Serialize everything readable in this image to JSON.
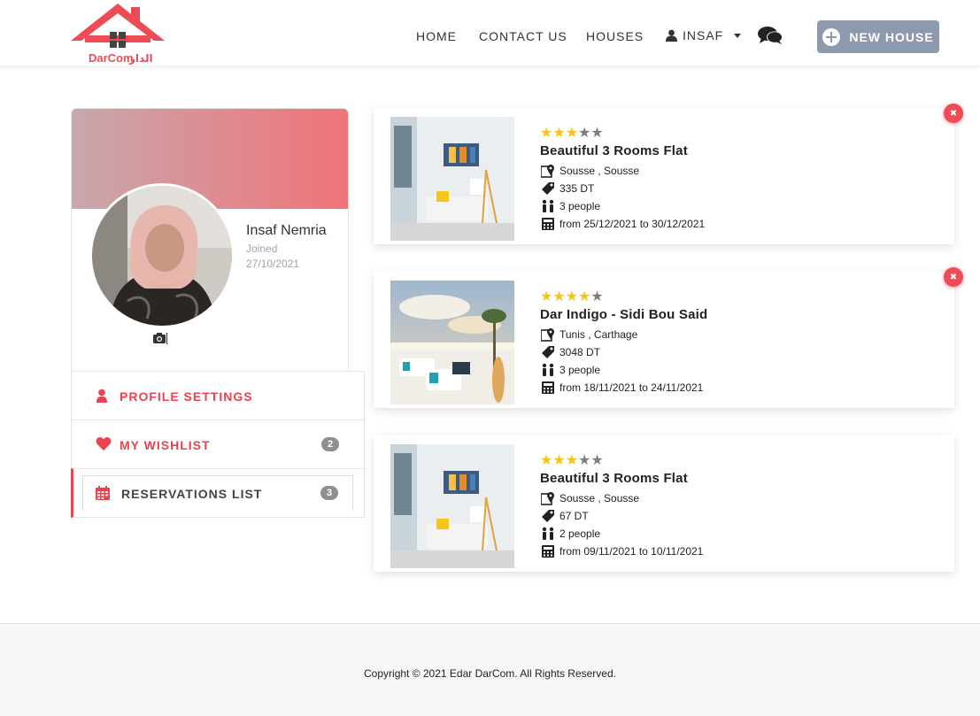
{
  "brand": {
    "logo_text_latin": "DarCom",
    "logo_text_arabic": "الدار",
    "primary_color": "#e8434e",
    "star_color": "#f5c518"
  },
  "nav": {
    "home": "HOME",
    "contact": "CONTACT US",
    "houses": "HOUSES",
    "user": "INSAF",
    "user_icon": "user-icon",
    "chat_icon": "chat-icon",
    "new_house": "NEW HOUSE"
  },
  "profile": {
    "name": "Insaf Nemria",
    "joined_label": "Joined",
    "joined_date": "27/10/2021"
  },
  "menu": [
    {
      "label": "PROFILE SETTINGS",
      "icon": "user-icon",
      "badge": ""
    },
    {
      "label": "MY WISHLIST",
      "icon": "heart-icon",
      "badge": "2"
    },
    {
      "label": "RESERVATIONS LIST",
      "icon": "calendar-icon",
      "badge": "3"
    }
  ],
  "reservations": [
    {
      "rating": 3,
      "max_rating": 5,
      "title": "Beautiful 3 Rooms Flat",
      "location": "Sousse , Sousse",
      "price": "335 DT",
      "people": "3 people",
      "dates": "from 25/12/2021 to 30/12/2021",
      "deletable": true
    },
    {
      "rating": 4,
      "max_rating": 5,
      "title": "Dar Indigo - Sidi Bou Said",
      "location": "Tunis , Carthage",
      "price": "3048 DT",
      "people": "3 people",
      "dates": "from 18/11/2021 to 24/11/2021",
      "deletable": true
    },
    {
      "rating": 3,
      "max_rating": 5,
      "title": "Beautiful 3 Rooms Flat",
      "location": "Sousse , Sousse",
      "price": "67 DT",
      "people": "2 people",
      "dates": "from 09/11/2021 to 10/11/2021",
      "deletable": false
    }
  ],
  "footer": {
    "copyright": "Copyright © 2021 Edar DarCom. All Rights Reserved."
  }
}
